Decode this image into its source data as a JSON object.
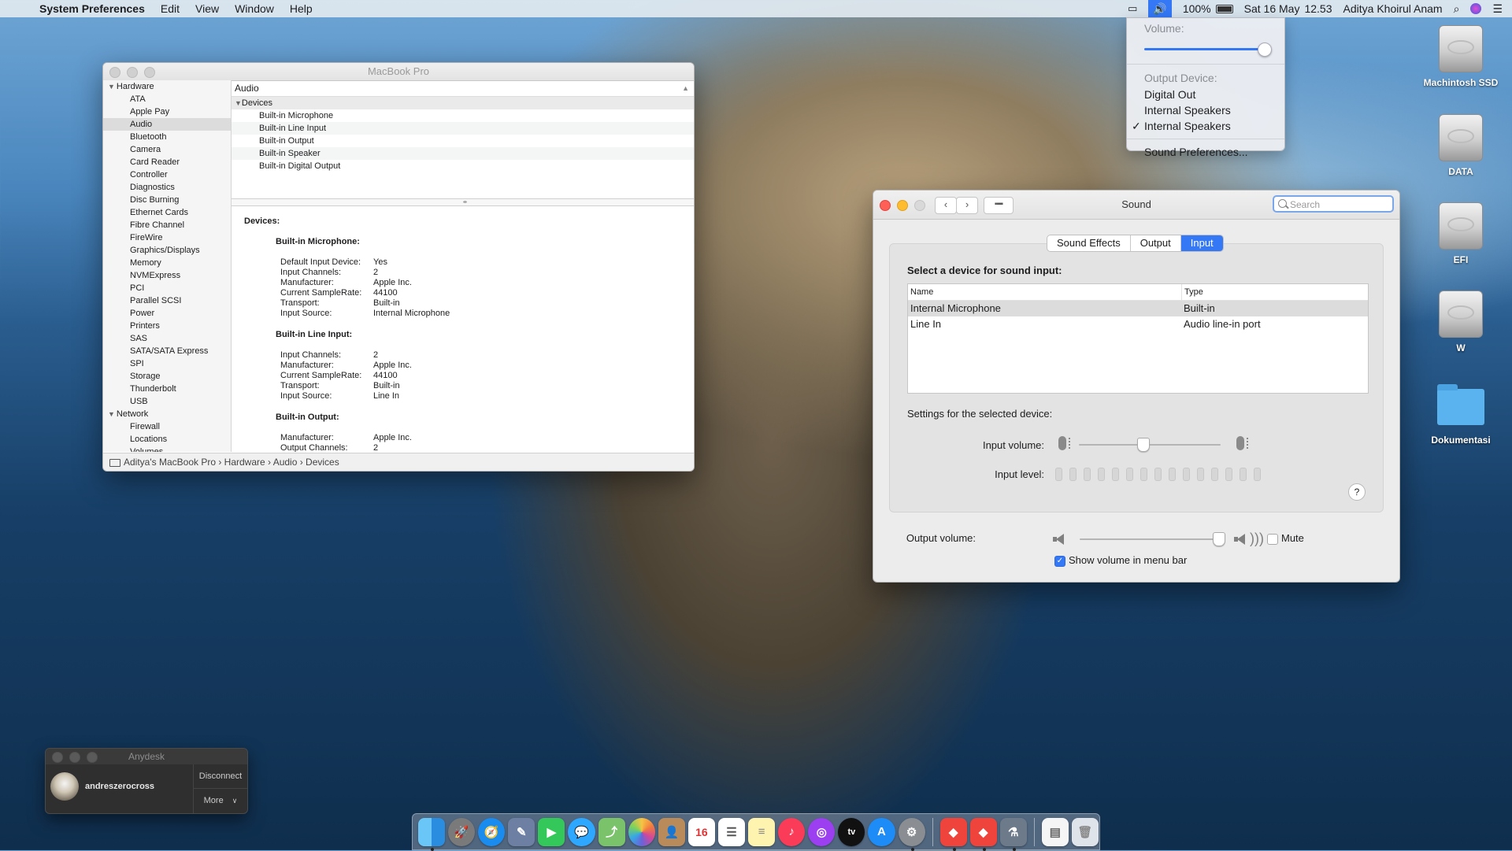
{
  "menubar": {
    "apple": "",
    "app": "System Preferences",
    "items": [
      "Edit",
      "View",
      "Window",
      "Help"
    ],
    "battery": "100%",
    "date": "Sat 16 May",
    "time": "12.53",
    "user": "Aditya Khoirul Anam"
  },
  "volume_menu": {
    "volume_label": "Volume:",
    "volume_level": 1.0,
    "output_label": "Output Device:",
    "devices": [
      "Digital Out",
      "Internal Speakers",
      "Internal Speakers"
    ],
    "checked": "✓",
    "prefs": "Sound Preferences..."
  },
  "desktop": {
    "icons": [
      "Machintosh SSD",
      "DATA",
      "EFI",
      "W",
      "Dokumentasi"
    ]
  },
  "sysinfo": {
    "title": "MacBook Pro",
    "sidebar": {
      "hardware": "Hardware",
      "hardware_items": [
        "ATA",
        "Apple Pay",
        "Audio",
        "Bluetooth",
        "Camera",
        "Card Reader",
        "Controller",
        "Diagnostics",
        "Disc Burning",
        "Ethernet Cards",
        "Fibre Channel",
        "FireWire",
        "Graphics/Displays",
        "Memory",
        "NVMExpress",
        "PCI",
        "Parallel SCSI",
        "Power",
        "Printers",
        "SAS",
        "SATA/SATA Express",
        "SPI",
        "Storage",
        "Thunderbolt",
        "USB"
      ],
      "network": "Network",
      "network_items": [
        "Firewall",
        "Locations",
        "Volumes"
      ]
    },
    "column_header": "Audio",
    "tree_head": "Devices",
    "tree_items": [
      "Built-in Microphone",
      "Built-in Line Input",
      "Built-in Output",
      "Built-in Speaker",
      "Built-in Digital Output"
    ],
    "detail": {
      "heading": "Devices:",
      "mic_title": "Built-in Microphone:",
      "mic": [
        [
          "Default Input Device:",
          "Yes"
        ],
        [
          "Input Channels:",
          "2"
        ],
        [
          "Manufacturer:",
          "Apple Inc."
        ],
        [
          "Current SampleRate:",
          "44100"
        ],
        [
          "Transport:",
          "Built-in"
        ],
        [
          "Input Source:",
          "Internal Microphone"
        ]
      ],
      "line_title": "Built-in Line Input:",
      "line": [
        [
          "Input Channels:",
          "2"
        ],
        [
          "Manufacturer:",
          "Apple Inc."
        ],
        [
          "Current SampleRate:",
          "44100"
        ],
        [
          "Transport:",
          "Built-in"
        ],
        [
          "Input Source:",
          "Line In"
        ]
      ],
      "output_title": "Built-in Output:",
      "output": [
        [
          "Manufacturer:",
          "Apple Inc."
        ],
        [
          "Output Channels:",
          "2"
        ]
      ]
    },
    "status_path": "Aditya's MacBook Pro › Hardware › Audio › Devices"
  },
  "sound": {
    "title": "Sound",
    "search_placeholder": "Search",
    "tabs": [
      "Sound Effects",
      "Output",
      "Input"
    ],
    "active_tab": "Input",
    "select_label": "Select a device for sound input:",
    "col_name": "Name",
    "col_type": "Type",
    "devices": [
      {
        "name": "Internal Microphone",
        "type": "Built-in"
      },
      {
        "name": "Line In",
        "type": "Audio line-in port"
      }
    ],
    "settings_label": "Settings for the selected device:",
    "input_volume_label": "Input volume:",
    "input_volume_level": 0.45,
    "input_level_label": "Input level:",
    "help": "?",
    "output_volume_label": "Output volume:",
    "output_volume_level": 0.98,
    "mute_label": "Mute",
    "show_volume_label": "Show volume in menu bar"
  },
  "anydesk": {
    "title": "Anydesk",
    "user": "andreszerocross",
    "disconnect": "Disconnect",
    "more": "More"
  },
  "dock": {
    "apps": [
      "finder",
      "launchpad",
      "safari",
      "preview",
      "facetime",
      "messages",
      "maps",
      "photos",
      "contacts",
      "calendar",
      "reminders",
      "notes",
      "music",
      "podcasts",
      "tv",
      "app-store",
      "system-preferences",
      "anydesk",
      "anydesk-2",
      "automator",
      "documents",
      "trash"
    ],
    "calendar_day": "16",
    "tv_label": "tv"
  }
}
